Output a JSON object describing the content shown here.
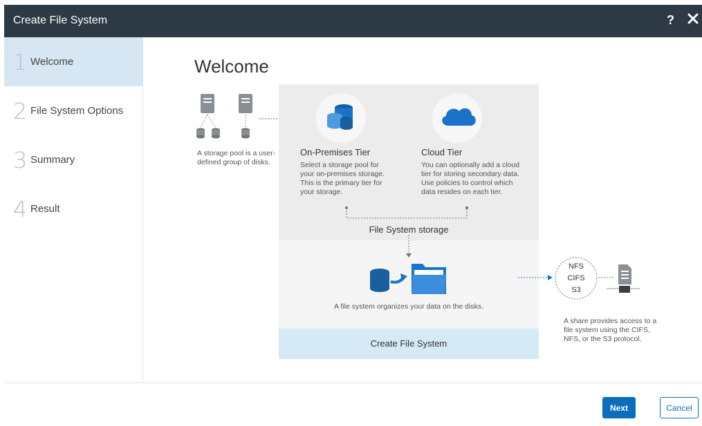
{
  "window": {
    "title": "Create File System",
    "help_label": "?"
  },
  "sidebar": {
    "steps": [
      {
        "number": "1",
        "label": "Welcome",
        "active": true
      },
      {
        "number": "2",
        "label": "File System Options",
        "active": false
      },
      {
        "number": "3",
        "label": "Summary",
        "active": false
      },
      {
        "number": "4",
        "label": "Result",
        "active": false
      }
    ]
  },
  "main": {
    "heading": "Welcome",
    "storage_pool_text": "A storage pool is a user-defined group of disks.",
    "on_prem": {
      "title": "On-Premises Tier",
      "description": "Select a storage pool for your on-premises storage. This is the primary tier for your storage."
    },
    "cloud": {
      "title": "Cloud Tier",
      "description": "You can optionally add a cloud tier for storing secondary data. Use policies to control which data resides on each tier."
    },
    "fs_storage_label": "File System storage",
    "fs_description": "A file system organizes your data on the disks.",
    "create_fs_label": "Create File System",
    "protocols": [
      "NFS",
      "CIFS",
      "S3"
    ],
    "share_text": "A share provides access to a file system using the CIFS, NFS, or the S3 protocol."
  },
  "footer": {
    "next_label": "Next",
    "cancel_label": "Cancel"
  },
  "colors": {
    "titlebar": "#2d3a45",
    "accent": "#0a6ebd",
    "active_step": "#d6e7f3",
    "panel_gray": "#ececec",
    "panel_blue": "#d6e9f7",
    "icon_blue": "#1a73c8"
  }
}
